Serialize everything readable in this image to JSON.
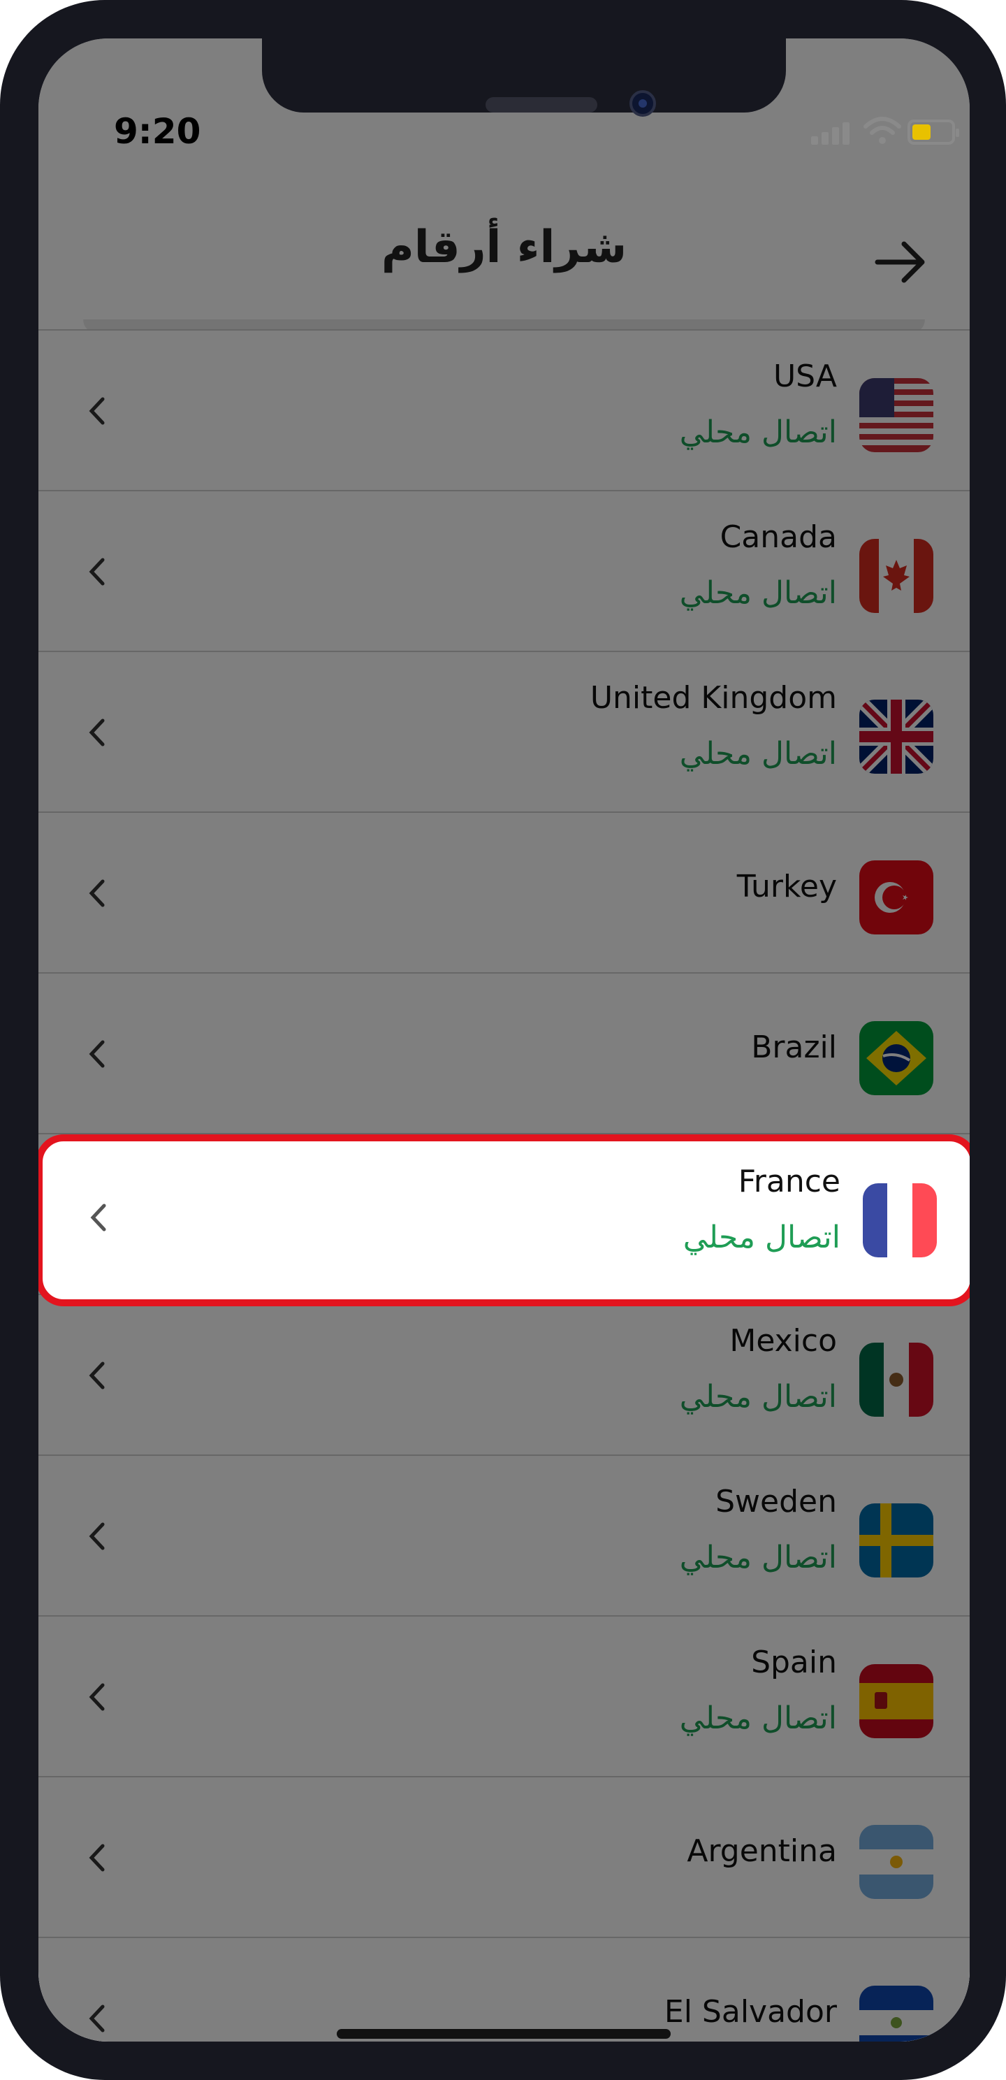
{
  "status_bar": {
    "time": "9:20"
  },
  "header": {
    "title": "شراء أرقام"
  },
  "countries": [
    {
      "name": "USA",
      "sub": "اتصال محلي",
      "flag": "us-flag"
    },
    {
      "name": "Canada",
      "sub": "اتصال محلي",
      "flag": "ca-flag"
    },
    {
      "name": "United Kingdom",
      "sub": "اتصال محلي",
      "flag": "gb-flag"
    },
    {
      "name": "Turkey",
      "sub": "",
      "flag": "tr-flag"
    },
    {
      "name": "Brazil",
      "sub": "",
      "flag": "br-flag"
    },
    {
      "name": "France",
      "sub": "اتصال محلي",
      "flag": "fr-flag"
    },
    {
      "name": "Mexico",
      "sub": "اتصال محلي",
      "flag": "mx-flag"
    },
    {
      "name": "Sweden",
      "sub": "اتصال محلي",
      "flag": "se-flag"
    },
    {
      "name": "Spain",
      "sub": "اتصال محلي",
      "flag": "es-flag"
    },
    {
      "name": "Argentina",
      "sub": "",
      "flag": "ar-flag"
    },
    {
      "name": "El Salvador",
      "sub": "",
      "flag": "sv-flag"
    }
  ],
  "colors": {
    "accent_green": "#1f9d55",
    "highlight_red": "#e3141e"
  }
}
